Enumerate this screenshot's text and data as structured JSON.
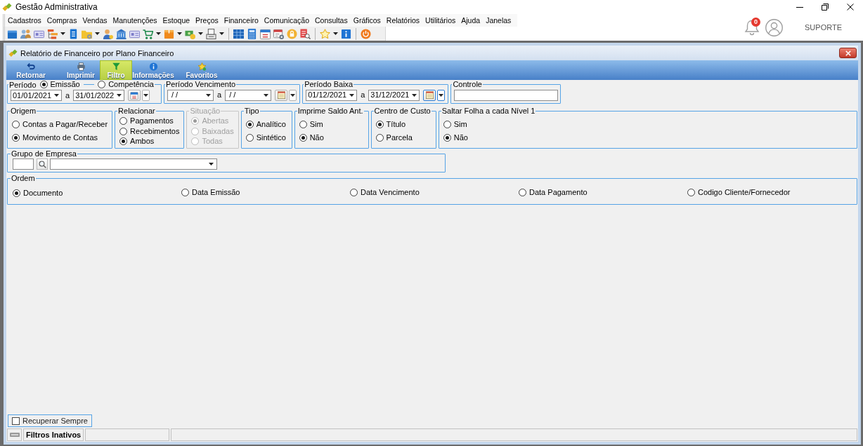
{
  "window": {
    "title": "Gestão Administrativa"
  },
  "menu": [
    "Cadastros",
    "Compras",
    "Vendas",
    "Manutenções",
    "Estoque",
    "Preços",
    "Financeiro",
    "Comunicação",
    "Consultas",
    "Gráficos",
    "Relatórios",
    "Utilitários",
    "Ajuda",
    "Janelas"
  ],
  "account": {
    "notifications": "0",
    "user": "SUPORTE"
  },
  "report_window": {
    "title": "Relatório de Financeiro por Plano Financeiro",
    "actions": [
      {
        "label": "Retornar",
        "selected": false
      },
      {
        "label": "Imprimir",
        "selected": false
      },
      {
        "label": "Filtro",
        "selected": true
      },
      {
        "label": "Informações",
        "selected": false
      },
      {
        "label": "Favoritos",
        "selected": false
      }
    ]
  },
  "date_groups": [
    {
      "legend": "Período",
      "options": [
        {
          "label": "Emissão",
          "selected": true
        },
        {
          "label": "Competência",
          "selected": false
        }
      ],
      "from": "01/01/2021",
      "separator": "a",
      "to": "31/01/2022",
      "focused": false
    },
    {
      "legend": "Período Vencimento",
      "from": "/ /",
      "separator": "a",
      "to": "/ /",
      "focused": false
    },
    {
      "legend": "Período Baixa",
      "from": "01/12/2021",
      "separator": "a",
      "to": "31/12/2021",
      "focused": true
    }
  ],
  "controle": {
    "legend": "Controle"
  },
  "option_groups": [
    {
      "legend": "Origem",
      "disabled": false,
      "options": [
        {
          "label": "Contas a Pagar/Receber",
          "selected": false
        },
        {
          "label": "Movimento de Contas",
          "selected": true
        }
      ]
    },
    {
      "legend": "Relacionar",
      "disabled": false,
      "options": [
        {
          "label": "Pagamentos",
          "selected": false
        },
        {
          "label": "Recebimentos",
          "selected": false
        },
        {
          "label": "Ambos",
          "selected": true
        }
      ]
    },
    {
      "legend": "Situação",
      "disabled": true,
      "options": [
        {
          "label": "Abertas",
          "selected": true
        },
        {
          "label": "Baixadas",
          "selected": false
        },
        {
          "label": "Todas",
          "selected": false
        }
      ]
    },
    {
      "legend": "Tipo",
      "disabled": false,
      "options": [
        {
          "label": "Analítico",
          "selected": true
        },
        {
          "label": "Sintético",
          "selected": false
        }
      ]
    },
    {
      "legend": "Imprime Saldo Ant.",
      "disabled": false,
      "options": [
        {
          "label": "Sim",
          "selected": false
        },
        {
          "label": "Não",
          "selected": true
        }
      ]
    },
    {
      "legend": "Centro de Custo",
      "disabled": false,
      "options": [
        {
          "label": "Título",
          "selected": true
        },
        {
          "label": "Parcela",
          "selected": false
        }
      ]
    },
    {
      "legend": "Saltar Folha a cada Nível 1",
      "disabled": false,
      "options": [
        {
          "label": "Sim",
          "selected": false
        },
        {
          "label": "Não",
          "selected": true
        }
      ]
    }
  ],
  "grupo_empresa": {
    "legend": "Grupo de Empresa"
  },
  "ordem": {
    "legend": "Ordem",
    "options": [
      {
        "label": "Documento",
        "selected": true
      },
      {
        "label": "Data Emissão",
        "selected": false
      },
      {
        "label": "Data Vencimento",
        "selected": false
      },
      {
        "label": "Data Pagamento",
        "selected": false
      },
      {
        "label": "Codigo Cliente/Fornecedor",
        "selected": false
      }
    ]
  },
  "recuperar_sempre": {
    "label": "Recuperar Sempre",
    "checked": false
  },
  "status_bar": {
    "filters": "Filtros Inativos"
  }
}
